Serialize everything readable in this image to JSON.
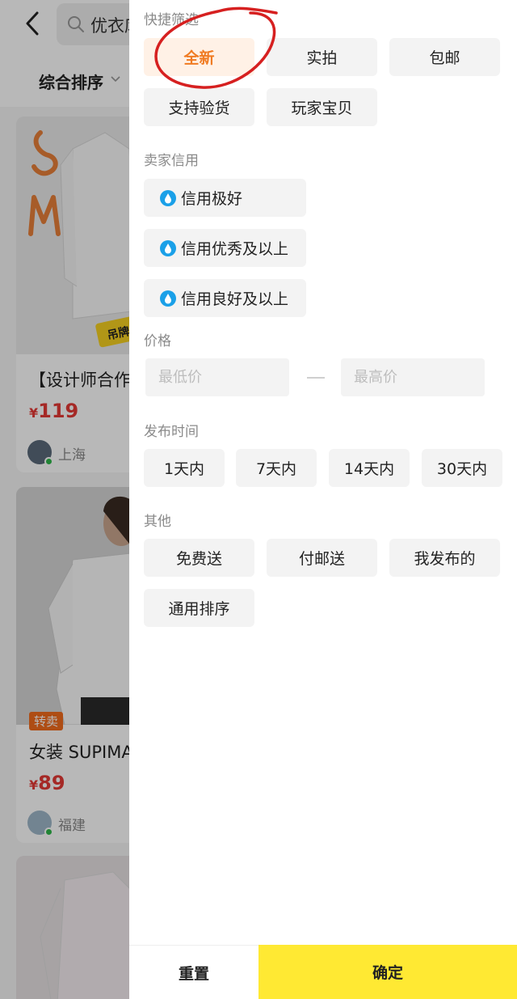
{
  "background": {
    "search_text": "优衣库",
    "sort_label": "综合排序",
    "cards": [
      {
        "title": "【设计师合作",
        "price_currency": "¥",
        "price": "119",
        "location": "上海",
        "image_letters": "SM",
        "tag_text": "吊牌"
      },
      {
        "title": "女装 SUPIMA",
        "price_currency": "¥",
        "price": "89",
        "location": "福建",
        "badge": "转卖"
      },
      {
        "title": ""
      }
    ]
  },
  "filter": {
    "quick_filter": {
      "title": "快捷筛选",
      "chips": [
        "全新",
        "实拍",
        "包邮",
        "支持验货",
        "玩家宝贝"
      ],
      "selected": "全新"
    },
    "seller_credit": {
      "title": "卖家信用",
      "chips": [
        "信用极好",
        "信用优秀及以上",
        "信用良好及以上"
      ],
      "icon": "water-drop-icon",
      "icon_color": "#1aa0e8"
    },
    "price": {
      "title": "价格",
      "min_placeholder": "最低价",
      "max_placeholder": "最高价"
    },
    "publish_time": {
      "title": "发布时间",
      "chips": [
        "1天内",
        "7天内",
        "14天内",
        "30天内"
      ]
    },
    "other": {
      "title": "其他",
      "chips": [
        "免费送",
        "付邮送",
        "我发布的",
        "通用排序"
      ]
    }
  },
  "footer": {
    "reset_label": "重置",
    "confirm_label": "确定"
  },
  "colors": {
    "accent": "#f07b22",
    "confirm_bg": "#ffe933",
    "price_red": "#e53935",
    "annotation_red": "#d62020"
  }
}
